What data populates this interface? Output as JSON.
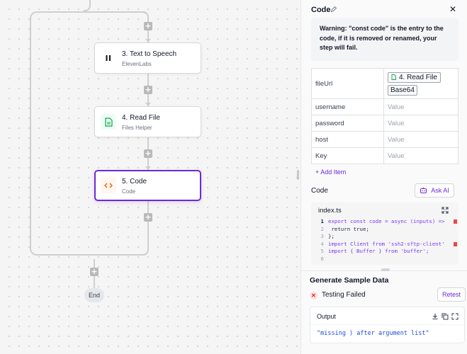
{
  "canvas": {
    "steps": [
      {
        "title": "3. Text to Speech",
        "subtitle": "ElevenLabs",
        "icon": "pause-icon"
      },
      {
        "title": "4. Read File",
        "subtitle": "Files Helper",
        "icon": "file-icon"
      },
      {
        "title": "5. Code",
        "subtitle": "Code",
        "icon": "code-icon"
      }
    ],
    "end_label": "End",
    "plus_label": "+"
  },
  "panel": {
    "title": "Code",
    "warning": "Warning: \"const code\" is the entry to the code, if it is removed or renamed, your step will fail.",
    "args": {
      "r0_key": "fileUrl",
      "r0_chip": "4. Read File",
      "r0_chip2": "Base64",
      "r1_key": "username",
      "r1_val": "Value",
      "r2_key": "password",
      "r2_val": "Value",
      "r3_key": "host",
      "r3_val": "Value",
      "r4_key": "Key",
      "r4_val": "Value"
    },
    "add_item": "+ Add Item",
    "code_label": "Code",
    "ask_ai": "Ask AI",
    "editor": {
      "filename": "index.ts",
      "lines": [
        {
          "n": "1",
          "text": "export const code = async (inputs) =>"
        },
        {
          "n": "2",
          "text": "  return true;"
        },
        {
          "n": "3",
          "text": "};"
        },
        {
          "n": "4",
          "text": "import Client from 'ssh2-sftp-client'"
        },
        {
          "n": "5",
          "text": "import { Buffer } from 'buffer';"
        },
        {
          "n": "6",
          "text": ""
        }
      ]
    },
    "generate_title": "Generate Sample Data",
    "status": "Testing Failed",
    "retest": "Retest",
    "output_label": "Output",
    "output_text": "\"missing ) after argument list\""
  },
  "colors": {
    "accent": "#6d28d9",
    "error": "#dc2626",
    "output_text": "#1d4ed8"
  }
}
